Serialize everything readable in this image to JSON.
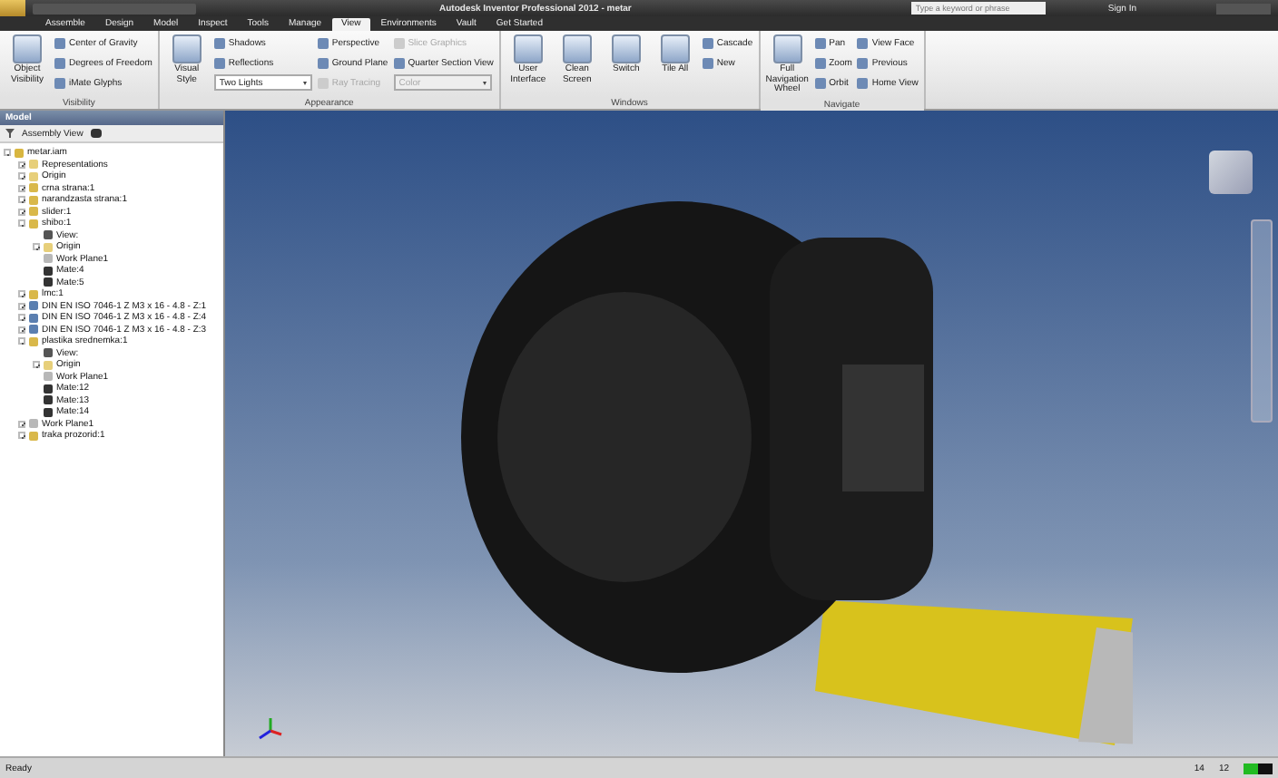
{
  "window": {
    "title": "Autodesk Inventor Professional 2012 - metar",
    "search_placeholder": "Type a keyword or phrase",
    "sign_in": "Sign In"
  },
  "tabs": [
    {
      "label": "Assemble",
      "selected": false
    },
    {
      "label": "Design",
      "selected": false
    },
    {
      "label": "Model",
      "selected": false
    },
    {
      "label": "Inspect",
      "selected": false
    },
    {
      "label": "Tools",
      "selected": false
    },
    {
      "label": "Manage",
      "selected": false
    },
    {
      "label": "View",
      "selected": true
    },
    {
      "label": "Environments",
      "selected": false
    },
    {
      "label": "Vault",
      "selected": false
    },
    {
      "label": "Get Started",
      "selected": false
    }
  ],
  "ribbon": [
    {
      "label": "Visibility",
      "columns": [
        [
          {
            "kind": "large",
            "label": "Object Visibility",
            "disabled": false
          }
        ],
        [
          {
            "kind": "small",
            "label": "Center of Gravity",
            "disabled": false
          },
          {
            "kind": "small",
            "label": "Degrees of Freedom",
            "disabled": false
          },
          {
            "kind": "small",
            "label": "iMate Glyphs",
            "disabled": false
          }
        ]
      ]
    },
    {
      "label": "Appearance",
      "columns": [
        [
          {
            "kind": "large",
            "label": "Visual Style",
            "disabled": false
          }
        ],
        [
          {
            "kind": "small",
            "label": "Shadows",
            "disabled": false
          },
          {
            "kind": "small",
            "label": "Reflections",
            "disabled": false
          },
          {
            "kind": "dropdown",
            "label": "Two Lights",
            "disabled": false
          }
        ],
        [
          {
            "kind": "small",
            "label": "Perspective",
            "disabled": false
          },
          {
            "kind": "small",
            "label": "Ground Plane",
            "disabled": false
          },
          {
            "kind": "small",
            "label": "Ray Tracing",
            "disabled": true
          }
        ],
        [
          {
            "kind": "small",
            "label": "Slice Graphics",
            "disabled": true
          },
          {
            "kind": "small",
            "label": "Quarter Section View",
            "disabled": false
          },
          {
            "kind": "dropdown",
            "label": "Color",
            "disabled": true
          }
        ]
      ]
    },
    {
      "label": "Windows",
      "columns": [
        [
          {
            "kind": "large",
            "label": "User Interface",
            "disabled": false
          }
        ],
        [
          {
            "kind": "large",
            "label": "Clean Screen",
            "disabled": false
          }
        ],
        [
          {
            "kind": "large",
            "label": "Switch",
            "disabled": false
          }
        ],
        [
          {
            "kind": "large",
            "label": "Tile All",
            "disabled": false
          }
        ],
        [
          {
            "kind": "small",
            "label": "Cascade",
            "disabled": false
          },
          {
            "kind": "small",
            "label": "New",
            "disabled": false
          }
        ]
      ]
    },
    {
      "label": "Navigate",
      "columns": [
        [
          {
            "kind": "large",
            "label": "Full Navigation Wheel",
            "disabled": false
          }
        ],
        [
          {
            "kind": "small",
            "label": "Pan",
            "disabled": false
          },
          {
            "kind": "small",
            "label": "Zoom",
            "disabled": false
          },
          {
            "kind": "small",
            "label": "Orbit",
            "disabled": false
          }
        ],
        [
          {
            "kind": "small",
            "label": "View Face",
            "disabled": false
          },
          {
            "kind": "small",
            "label": "Previous",
            "disabled": false
          },
          {
            "kind": "small",
            "label": "Home View",
            "disabled": false
          }
        ]
      ]
    }
  ],
  "browser": {
    "title": "Model",
    "view": "Assembly View",
    "tree": [
      {
        "label": "metar.iam",
        "kind": "assembly",
        "expanded": true,
        "children": [
          {
            "label": "Representations",
            "kind": "folder",
            "expanded": false
          },
          {
            "label": "Origin",
            "kind": "folder",
            "expanded": false
          },
          {
            "label": "crna strana:1",
            "kind": "part",
            "expanded": false
          },
          {
            "label": "narandzasta strana:1",
            "kind": "part",
            "expanded": false
          },
          {
            "label": "slider:1",
            "kind": "part",
            "expanded": false
          },
          {
            "label": "shibo:1",
            "kind": "part",
            "expanded": true,
            "children": [
              {
                "label": "View:",
                "kind": "view"
              },
              {
                "label": "Origin",
                "kind": "folder",
                "expanded": false
              },
              {
                "label": "Work Plane1",
                "kind": "plane"
              },
              {
                "label": "Mate:4",
                "kind": "mate"
              },
              {
                "label": "Mate:5",
                "kind": "mate"
              }
            ]
          },
          {
            "label": "lmc:1",
            "kind": "part",
            "expanded": false
          },
          {
            "label": "DIN EN ISO 7046-1 Z M3 x 16 - 4.8 - Z:1",
            "kind": "bolt",
            "expanded": false
          },
          {
            "label": "DIN EN ISO 7046-1 Z M3 x 16 - 4.8 - Z:4",
            "kind": "bolt",
            "expanded": false
          },
          {
            "label": "DIN EN ISO 7046-1 Z M3 x 16 - 4.8 - Z:3",
            "kind": "bolt",
            "expanded": false
          },
          {
            "label": "plastika srednemka:1",
            "kind": "part",
            "expanded": true,
            "children": [
              {
                "label": "View:",
                "kind": "view"
              },
              {
                "label": "Origin",
                "kind": "folder",
                "expanded": false
              },
              {
                "label": "Work Plane1",
                "kind": "plane"
              },
              {
                "label": "Mate:12",
                "kind": "mate"
              },
              {
                "label": "Mate:13",
                "kind": "mate"
              },
              {
                "label": "Mate:14",
                "kind": "mate"
              }
            ]
          },
          {
            "label": "Work Plane1",
            "kind": "plane",
            "expanded": false
          },
          {
            "label": "traka prozorid:1",
            "kind": "part",
            "expanded": false
          }
        ]
      }
    ]
  },
  "status_bar": {
    "text": "Ready",
    "counts": [
      "14",
      "12"
    ]
  }
}
